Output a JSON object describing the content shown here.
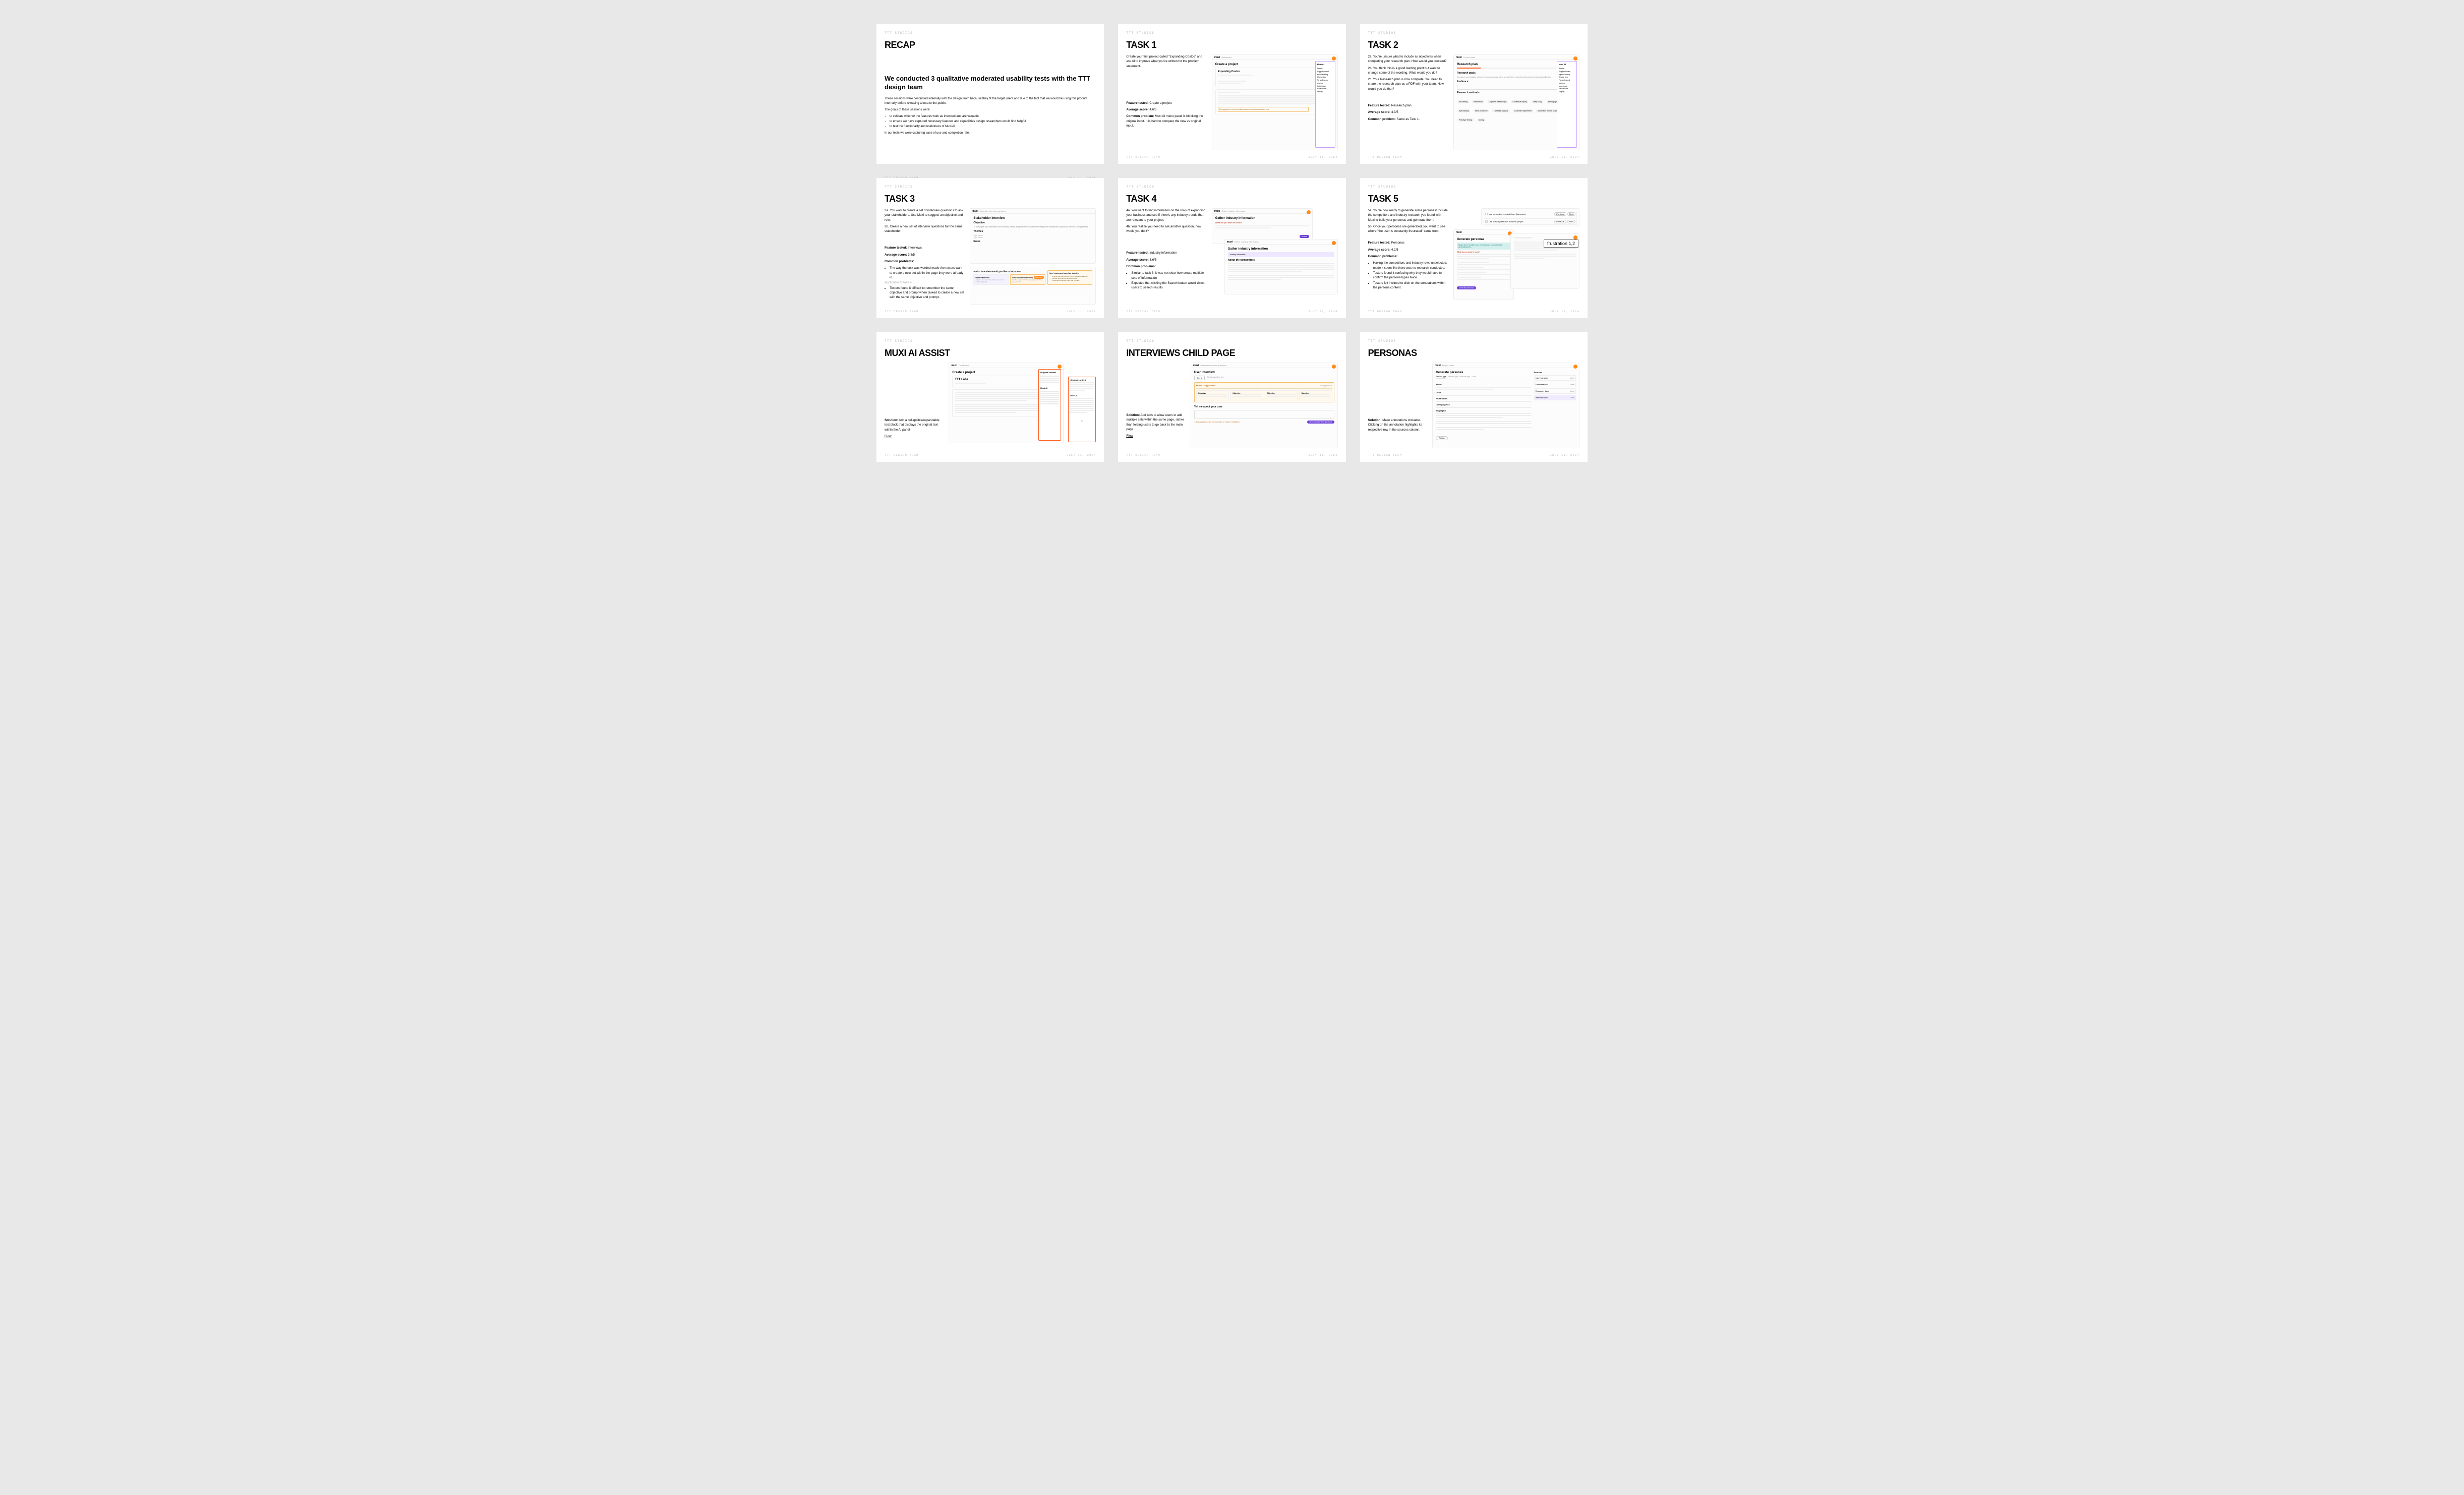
{
  "common": {
    "studio": "TTT STUDIOS",
    "team": "TTT DESIGN TEAM",
    "date": "JULY 11, 2024",
    "logo": "muxi",
    "flow": "Flow"
  },
  "cards": {
    "recap": {
      "title": "RECAP",
      "headline": "We conducted 3 qualitative moderated usability tests with the TTT design team",
      "intro": "These sessions were conducted internally with the design team because they fit the target users and due to the fact that we would be using this product internally before releasing a beta to the public.",
      "goals_label": "The goals of these sessions were:",
      "goals": [
        "to validate whether the features work as intended and are valuable",
        "to ensure we have captured necessary features and capabilities design researchers would find helpful",
        "to test the functionality and usefulness of Muxi AI"
      ],
      "closing": "In our tests we were capturing ease of use and completion rate."
    },
    "task1": {
      "title": "TASK 1",
      "prompt": "Create your first project called \"Expanding Costco\" and ask AI to improve what you've written for the problem statement.",
      "feature_label": "Feature tested:",
      "feature": "Create a project",
      "score_label": "Average score:",
      "score": "4.6/5",
      "problem_label": "Common problem:",
      "problem": "Muxi AI menu panel is blocking the original input. It is hard to compare the new vs original input.",
      "mock": {
        "crumb": "Dashboard",
        "heading": "Create a project",
        "project_name": "Expanding Costco",
        "panel_hdr": "Muxi AI",
        "menu": [
          "Rewrite",
          "Suggest content",
          "Improve writing",
          "Change tone",
          "Fix spelling and grammar",
          "Make longer",
          "Make shorter",
          "Simplify"
        ]
      }
    },
    "task2": {
      "title": "TASK 2",
      "p2a": "2a. You're unsure what to include as objectives when completing your research plan. How would you proceed?",
      "p2b": "2b. You think this is a good starting point but want to change some of the wording. What would you do?",
      "p2c": "2c. Your Research plan is now complete. You need to share the research plan as a PDF with your team. How would you do that?",
      "feature_label": "Feature tested:",
      "feature": "Research plan",
      "score_label": "Average score:",
      "score": "4.3/5",
      "problem_label": "Common problem:",
      "problem": "Same as Task 1.",
      "mock": {
        "crumb": "Project name",
        "heading": "Research plan",
        "goals_hdr": "Research goals",
        "goals_sub": "To uncover poor insights and enhance understanding within specific field or topic through comprehensive data collection.",
        "aud_hdr": "Audience",
        "methods_hdr": "Research methods",
        "methods": [
          "A/B testing",
          "Benchmark",
          "Cognitive walkthrough",
          "Contextual inquiry",
          "Diary study",
          "Ethnographic field",
          "Eye tracking",
          "Semi-structured",
          "Literature analysis",
          "Controlled experiment",
          "Moderated remote usability testing",
          "Prototype testing",
          "Survey"
        ],
        "panel_hdr": "Muxi AI",
        "menu": [
          "Rewrite",
          "Suggest content",
          "Improve writing",
          "Change tone",
          "Fix spelling and grammar",
          "Make longer",
          "Make shorter",
          "Simplify"
        ]
      }
    },
    "task3": {
      "title": "TASK 3",
      "p3a": "3a. You want to create a set of interview questions to ask your stakeholders. Use Muxi to suggest an objective and role.",
      "p3b": "3b. Create a new set of interview questions for the same stakeholder.",
      "feature_label": "Feature tested:",
      "feature": "Interviews",
      "score_label": "Average score:",
      "score": "3.8/5",
      "problems_label": "Common problems:",
      "problems": [
        "The way the task was worded made the testers want to create a new set within the page they were already in.",
        "Applicable to task 4.",
        "Testers found it difficult to remember the same objective and prompt when tasked to create a new set with the same objective and prompt."
      ],
      "mock_top": {
        "crumb": "Generate interview questions",
        "heading": "Stakeholder interview",
        "obj_hdr": "Objective",
        "obj_text": "To investigate and understand user behaviors, needs, and preferences to inform the design and development of products, services, or experiences.",
        "themes_hdr": "Themes",
        "themes": [
          "Type theme",
          "Type theme"
        ],
        "roles_hdr": "Roles"
      },
      "mock_bot": {
        "prompt": "Which interview would you like to focus on?",
        "left": "User interview",
        "left_sub": "Ask your end users about their pain points, needs, and goals.",
        "right": "Stakeholder interview",
        "right_sub": "Ask the people involved in your project about their priorities.",
        "badge": "Selected",
        "ai_hdr": "Here's summary based on objective",
        "ai_points": [
          "explore and gain insights into the specific challenges",
          "identify pain points or areas of friction",
          "understand business goals and priorities"
        ]
      }
    },
    "task4": {
      "title": "TASK 4",
      "p4a": "4a. You want to find information on the risks of expanding your business and see if there's any industry trends that are relevant to your project.",
      "p4b": "4b. You realize you need to ask another question, how would you do it?",
      "feature_label": "Feature tested:",
      "feature": "Industry information",
      "score_label": "Average score:",
      "score": "3.6/5",
      "problems_label": "Common problems:",
      "problems": [
        "Similar to task 3, it was not clear how create multiple sets of information",
        "Expected that clicking the Search button would direct users to search results"
      ],
      "mock_top": {
        "crumb": "Gather industry information",
        "heading": "Gather industry information",
        "q_hdr": "What do you want to know?",
        "send": "Search"
      },
      "mock_bot": {
        "crumb": "Gather industry information",
        "heading": "Gather industry information",
        "section": "Industry information",
        "about": "About the competitors"
      }
    },
    "task5": {
      "title": "TASK 5",
      "p5a": "5a. You're now ready to generate some personas! Include the competitors and industry research you found with Muxi to build your personas and generate them.",
      "p5b": "5b. Once your personas are generated, you want to see where \"the user is constantly frustrated\" came from.",
      "feature_label": "Feature tested:",
      "feature": "Personas",
      "score_label": "Average score:",
      "score": "4.2/5",
      "problems_label": "Common problems:",
      "problems": [
        "Having the competitors and industry rows unselected, made it seem like there was no research conducted.",
        "Testers found it confusing why they would have to confirm the persona types twice.",
        "Testers felt inclined to click on the annotations within the persona content."
      ],
      "mock_top": {
        "row1": "Use competitor research from this project",
        "row2": "Use industry research from this project",
        "btn_prev": "Previous",
        "btn_next": "Next"
      },
      "mock_mid": {
        "heading": "Generate personas",
        "teal_hdr": "Nearly there! Confirm your personas and Muxi can start generating them.",
        "q_hdr": "What do you want to know?",
        "purple_btn": "Generate personas"
      },
      "frustration": "frustration 1,2"
    },
    "muxi": {
      "title": "MUXI AI ASSIST",
      "solution_label": "Solution:",
      "solution": "Add a collapsible/expandable text block that displays the original text within the AI panel",
      "mock": {
        "crumb": "Dashboard",
        "heading": "Create a project",
        "project": "TTT Labs",
        "panel1": "Original content",
        "panel2": "Muxi AI"
      }
    },
    "interviews": {
      "title": "INTERVIEWS CHILD PAGE",
      "solution_label": "Solution:",
      "solution": "Add tabs to allow users to add multiple sets within the same page, rather than forcing users to go back to the main page",
      "mock": {
        "crumb": "Generate interview questions",
        "heading": "User interview",
        "tab1": "Set 1",
        "tab2": "Create another set",
        "ai_hdr": "Muxi AI suggestions",
        "suggestions_count": "4 suggestions",
        "card_hdr": "Objective",
        "prompt_hdr": "Tell me about your user",
        "btn": "Generate interview questions"
      }
    },
    "personas": {
      "title": "PERSONAS",
      "solution_label": "Solution:",
      "solution": "Make annotations clickable. Clicking on the annotation highlights its respective row in the sources column.",
      "mock": {
        "crumb": "Project name",
        "heading": "Generate personas",
        "tabs": [
          "Persona type",
          "Persona type",
          "Persona type"
        ],
        "add": "+ Add",
        "sections": [
          "About",
          "Goals",
          "Frustrations",
          "Demographics",
          "Biography"
        ],
        "sources_hdr": "Sources",
        "src_items": [
          "Interview with",
          "User research",
          "Research data",
          "Interview with"
        ],
        "view": "View",
        "btn": "Refresh"
      }
    }
  }
}
